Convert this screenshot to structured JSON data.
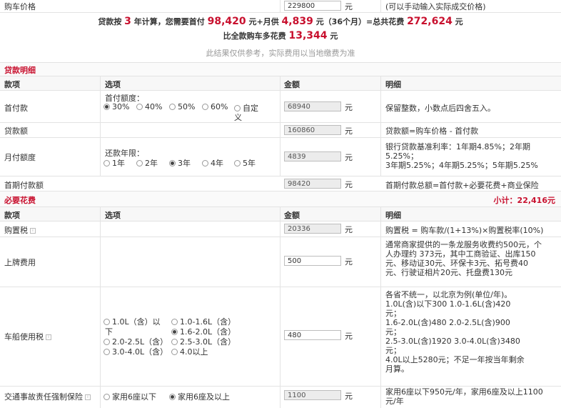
{
  "price_row": {
    "label": "购车价格",
    "value": "229800",
    "unit": "元",
    "hint": "(可以手动输入实际成交价格)"
  },
  "summary": {
    "p1": "贷款按",
    "years": "3",
    "p2": "年计算，您需要首付",
    "down_payment": "98,420",
    "p3": "元+月供",
    "monthly": "4,839",
    "p4": "元（36个月）=总共花费",
    "total": "272,624",
    "p5": "元",
    "extra_label": "比全款购车多花费",
    "extra": "13,344",
    "extra_unit": "元",
    "disclaimer": "此结果仅供参考，实际费用以当地缴费为准"
  },
  "loan": {
    "title": "贷款明细",
    "headers": [
      "款项",
      "选项",
      "金额",
      "明细"
    ],
    "down": {
      "label": "首付款",
      "option_label": "首付额度：",
      "options": [
        "30%",
        "40%",
        "50%",
        "60%",
        "自定"
      ],
      "options_cont": "义",
      "selected": "30%",
      "amount": "68940",
      "unit": "元",
      "note": "保留整数，小数点后四舍五入。"
    },
    "loan_amount": {
      "label": "贷款额",
      "amount": "160860",
      "unit": "元",
      "note": "贷款额=购车价格 - 首付款"
    },
    "monthly": {
      "label": "月付额度",
      "option_label": "还款年限：",
      "options": [
        "1年",
        "2年",
        "3年",
        "4年",
        "5年"
      ],
      "selected": "3年",
      "amount": "4839",
      "unit": "元",
      "note_lines": [
        "银行贷款基准利率：1年期4.85%；2年期",
        "5.25%；",
        "3年期5.25%；4年期5.25%；5年期5.25%"
      ]
    },
    "first_pay": {
      "label": "首期付款额",
      "amount": "98420",
      "unit": "元",
      "note": "首期付款总额=首付款+必要花费+商业保险"
    }
  },
  "required": {
    "title": "必要花费",
    "subtotal": "小计：22,416元",
    "headers": [
      "款项",
      "选项",
      "金额",
      "明细"
    ],
    "purchase_tax": {
      "label": "购置税",
      "amount": "20336",
      "unit": "元",
      "note": "购置税 = 购车款/(1+13%)×购置税率(10%)"
    },
    "plate": {
      "label": "上牌费用",
      "amount": "500",
      "unit": "元",
      "note_lines": [
        "通常商家提供的一条龙服务收费约500元，个",
        "人办理约 373元，其中工商验证、出库150",
        "元、移动证30元、环保卡3元、拓号费40",
        "元、行驶证相片20元、托盘费130元"
      ]
    },
    "vehicle_tax": {
      "label": "车船使用税",
      "options": [
        "1.0L（含）以",
        "1.0-1.6L（含）",
        "下",
        "1.6-2.0L（含）",
        "2.0-2.5L（含）",
        "2.5-3.0L（含）",
        "3.0-4.0L（含）",
        "4.0以上"
      ],
      "selected": "1.6-2.0L（含）",
      "amount": "480",
      "unit": "元",
      "note_lines": [
        "各省不统一，以北京为例(单位/年)。",
        "1.0L(含)以下300  1.0-1.6L(含)420",
        "元；",
        "1.6-2.0L(含)480  2.0-2.5L(含)900",
        "元；",
        "2.5-3.0L(含)1920 3.0-4.0L(含)3480",
        "元；",
        "4.0L以上5280元；不足一年按当年剩余",
        "月算。"
      ]
    },
    "compulsory": {
      "label": "交通事故责任强制保险",
      "options": [
        "家用6座以下",
        "家用6座及以上"
      ],
      "selected": "家用6座及以上",
      "amount": "1100",
      "unit": "元",
      "note_lines": [
        "家用6座以下950元/年，家用6座及以上1100",
        "元/年"
      ]
    }
  }
}
